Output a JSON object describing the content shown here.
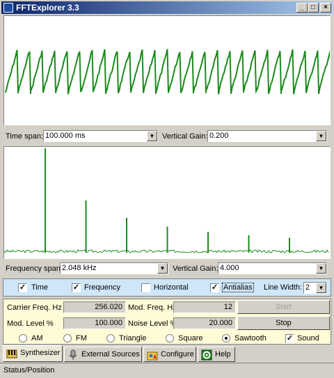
{
  "window": {
    "title": "FFTExplorer 3.3",
    "min": "_",
    "max": "□",
    "close": "×"
  },
  "time_panel": {
    "span_label": "Time span:",
    "span_value": "100.000 ms",
    "gain_label": "Vertical Gain:",
    "gain_value": "0.200",
    "waveform": "sawtooth",
    "cycles": 26
  },
  "freq_panel": {
    "span_label": "Frequency span:",
    "span_value": "2.048 kHz",
    "gain_label": "Vertical Gain:",
    "gain_value": "4.000",
    "harmonics": [
      1.0,
      0.5,
      0.333,
      0.25,
      0.2,
      0.167,
      0.143
    ]
  },
  "options": {
    "time": {
      "label": "Time",
      "checked": true
    },
    "frequency": {
      "label": "Frequency",
      "checked": true
    },
    "horizontal": {
      "label": "Horizontal",
      "checked": false
    },
    "antialias": {
      "label": "Antialias",
      "checked": true
    },
    "line_width_label": "Line Width:",
    "line_width": "2"
  },
  "synth": {
    "carrier_label": "Carrier Freq. Hz",
    "carrier_value": "256.020",
    "mod_freq_label": "Mod. Freq. Hz",
    "mod_freq_value": "12",
    "mod_level_label": "Mod. Level %",
    "mod_level_value": "100.000",
    "noise_label": "Noise Level %",
    "noise_value": "20.000",
    "start_label": "Start",
    "stop_label": "Stop",
    "am": "AM",
    "fm": "FM",
    "triangle": "Triangle",
    "square": "Square",
    "sawtooth": "Sawtooth",
    "sound": "Sound",
    "selected_wave": "Sawtooth",
    "sound_on": true
  },
  "tabs": [
    "Synthesizer",
    "External Sources",
    "Configure",
    "Help"
  ],
  "status": "Status/Position",
  "colors": {
    "trace": "#1a8a1a",
    "band": "#cfe6f8",
    "controls": "#fffbd6"
  }
}
